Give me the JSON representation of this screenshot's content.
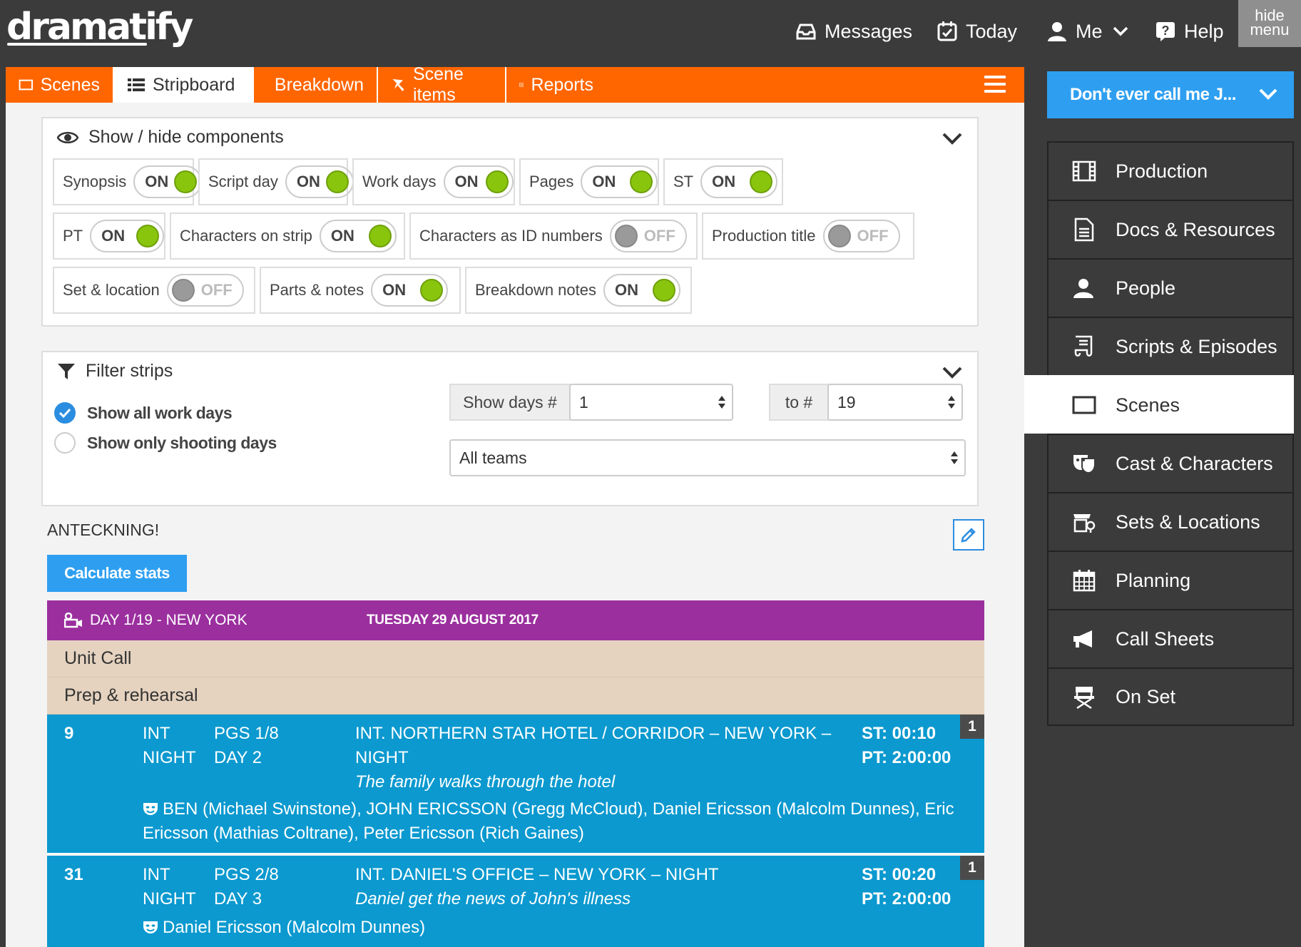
{
  "app": {
    "logo": "dramatify"
  },
  "topnav": {
    "messages": "Messages",
    "today": "Today",
    "me": "Me",
    "help": "Help",
    "hide_menu_1": "hide",
    "hide_menu_2": "menu"
  },
  "tabs": [
    {
      "label": "Scenes",
      "icon": "scenes-icon"
    },
    {
      "label": "Stripboard",
      "icon": "list-icon"
    },
    {
      "label": "Breakdown",
      "icon": "breakdown-icon"
    },
    {
      "label": "Scene items",
      "icon": "scene-items-icon"
    },
    {
      "label": "Reports",
      "icon": "reports-icon"
    }
  ],
  "components": {
    "title": "Show / hide components",
    "items": [
      {
        "label": "Synopsis",
        "state": "ON"
      },
      {
        "label": "Script day",
        "state": "ON"
      },
      {
        "label": "Work days",
        "state": "ON"
      },
      {
        "label": "Pages",
        "state": "ON"
      },
      {
        "label": "ST",
        "state": "ON"
      },
      {
        "label": "PT",
        "state": "ON"
      },
      {
        "label": "Characters on strip",
        "state": "ON"
      },
      {
        "label": "Characters as ID numbers",
        "state": "OFF"
      },
      {
        "label": "Production title",
        "state": "OFF"
      },
      {
        "label": "Set & location",
        "state": "OFF"
      },
      {
        "label": "Parts & notes",
        "state": "ON"
      },
      {
        "label": "Breakdown notes",
        "state": "ON"
      }
    ]
  },
  "filter": {
    "title": "Filter strips",
    "show_all": "Show all work days",
    "show_shooting": "Show only shooting days",
    "show_days_label": "Show days #",
    "from_value": "1",
    "to_label": "to #",
    "to_value": "19",
    "team_value": "All teams"
  },
  "note_text": "ANTECKNING!",
  "calc_button": "Calculate stats",
  "day": {
    "title": "DAY 1/19 - NEW YORK",
    "date": "TUESDAY 29 AUGUST 2017",
    "unit_call": "Unit Call",
    "prep": "Prep & rehearsal"
  },
  "strips": [
    {
      "num": "9",
      "ie": "INT",
      "time": "NIGHT",
      "pgs": "PGS 1/8",
      "sday": "DAY 2",
      "heading1": "INT. NORTHERN STAR HOTEL / CORRIDOR – NEW YORK –",
      "heading2": "NIGHT",
      "synopsis": "The family walks through the hotel",
      "st": "ST: 00:10",
      "pt": "PT: 2:00:00",
      "badge": "1",
      "cast": "BEN (Michael Swinstone), JOHN ERICSSON (Gregg McCloud), Daniel Ericsson (Malcolm Dunnes), Eric Ericsson (Mathias Coltrane), Peter Ericsson (Rich Gaines)"
    },
    {
      "num": "31",
      "ie": "INT",
      "time": "NIGHT",
      "pgs": "PGS 2/8",
      "sday": "DAY 3",
      "heading1": "INT. DANIEL'S OFFICE – NEW YORK – NIGHT",
      "synopsis": "Daniel get the news of John's illness",
      "st": "ST: 00:20",
      "pt": "PT: 2:00:00",
      "badge": "1",
      "cast": "Daniel Ericsson (Malcolm Dunnes)"
    }
  ],
  "production_select": "Don't ever call me J...",
  "sidebar": [
    {
      "label": "Production",
      "icon": "film-icon"
    },
    {
      "label": "Docs & Resources",
      "icon": "document-icon"
    },
    {
      "label": "People",
      "icon": "people-icon"
    },
    {
      "label": "Scripts & Episodes",
      "icon": "script-icon"
    },
    {
      "label": "Scenes",
      "icon": "scene-icon",
      "active": true
    },
    {
      "label": "Cast & Characters",
      "icon": "masks-icon"
    },
    {
      "label": "Sets & Locations",
      "icon": "location-icon"
    },
    {
      "label": "Planning",
      "icon": "calendar-icon"
    },
    {
      "label": "Call Sheets",
      "icon": "megaphone-icon"
    },
    {
      "label": "On Set",
      "icon": "director-chair-icon"
    }
  ]
}
